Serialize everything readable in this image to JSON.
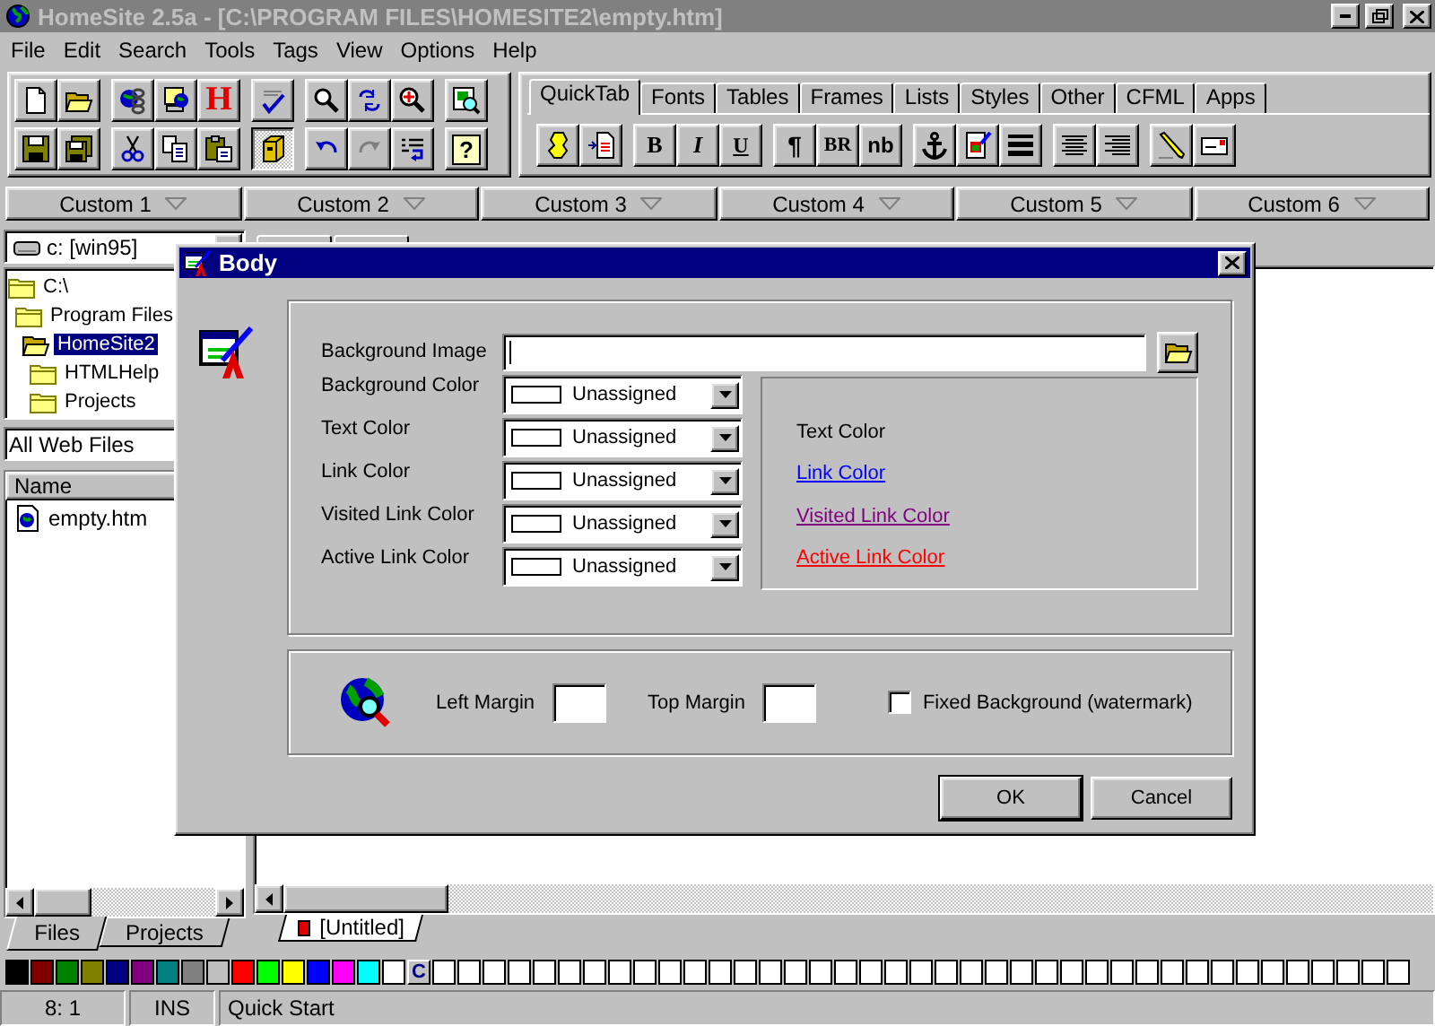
{
  "window": {
    "title": "HomeSite 2.5a - [C:\\PROGRAM FILES\\HOMESITE2\\empty.htm]",
    "active": false
  },
  "menu": [
    {
      "label": "File"
    },
    {
      "label": "Edit"
    },
    {
      "label": "Search"
    },
    {
      "label": "Tools"
    },
    {
      "label": "Tags"
    },
    {
      "label": "View"
    },
    {
      "label": "Options"
    },
    {
      "label": "Help"
    }
  ],
  "toolbar": {
    "html_button": "H",
    "help_button": "?",
    "tag_chooser_pressed": true,
    "redo_disabled": true
  },
  "quicktab": {
    "tabs": [
      {
        "label": "QuickTab",
        "selected": true
      },
      {
        "label": "Fonts",
        "selected": false
      },
      {
        "label": "Tables",
        "selected": false
      },
      {
        "label": "Frames",
        "selected": false
      },
      {
        "label": "Lists",
        "selected": false
      },
      {
        "label": "Styles",
        "selected": false
      },
      {
        "label": "Other",
        "selected": false
      },
      {
        "label": "CFML",
        "selected": false
      },
      {
        "label": "Apps",
        "selected": false
      }
    ],
    "text_buttons": [
      "B",
      "I",
      "U",
      "¶",
      "BR",
      "nb"
    ]
  },
  "custom_buttons": [
    "Custom 1",
    "Custom 2",
    "Custom 3",
    "Custom 4",
    "Custom 5",
    "Custom 6"
  ],
  "left_panel": {
    "drive": "c: [win95]",
    "tree": [
      {
        "label": "C:\\",
        "selected": false,
        "children": [
          {
            "label": "Program Files",
            "selected": false,
            "children": [
              {
                "label": "HomeSite2",
                "selected": true,
                "children": [
                  {
                    "label": "HTMLHelp",
                    "selected": false
                  },
                  {
                    "label": "Projects",
                    "selected": false
                  }
                ]
              }
            ]
          }
        ]
      }
    ],
    "filter": "All Web Files",
    "file_list": {
      "columns": [
        "Name"
      ],
      "rows": [
        "empty.htm"
      ]
    },
    "tabs": [
      {
        "label": "Files",
        "selected": true
      },
      {
        "label": "Projects",
        "selected": false
      }
    ]
  },
  "editor": {
    "doc_tabs": [
      {
        "label": "[Untitled]",
        "modified": true,
        "selected": true
      }
    ]
  },
  "palette": {
    "colors": [
      {
        "color": "#000000"
      },
      {
        "color": "#800000"
      },
      {
        "color": "#008000"
      },
      {
        "color": "#808000"
      },
      {
        "color": "#000080"
      },
      {
        "color": "#800080"
      },
      {
        "color": "#008080"
      },
      {
        "color": "#808080"
      },
      {
        "color": "#c0c0c0"
      },
      {
        "color": "#ff0000"
      },
      {
        "color": "#00ff00"
      },
      {
        "color": "#ffff00"
      },
      {
        "color": "#0000ff"
      },
      {
        "color": "#ff00ff"
      },
      {
        "color": "#00ffff"
      },
      {
        "color": "#ffffff"
      }
    ],
    "custom_button": "C",
    "custom_colors": [
      {
        "color": "#ffffff"
      },
      {
        "color": "#ffffff"
      },
      {
        "color": "#ffffff"
      },
      {
        "color": "#ffffff"
      },
      {
        "color": "#ffffff"
      },
      {
        "color": "#ffffff"
      },
      {
        "color": "#ffffff"
      },
      {
        "color": "#ffffff"
      },
      {
        "color": "#ffffff"
      },
      {
        "color": "#ffffff"
      },
      {
        "color": "#ffffff"
      },
      {
        "color": "#ffffff"
      },
      {
        "color": "#ffffff"
      },
      {
        "color": "#ffffff"
      },
      {
        "color": "#ffffff"
      },
      {
        "color": "#ffffff"
      },
      {
        "color": "#ffffff"
      },
      {
        "color": "#ffffff"
      },
      {
        "color": "#ffffff"
      },
      {
        "color": "#ffffff"
      },
      {
        "color": "#ffffff"
      },
      {
        "color": "#ffffff"
      },
      {
        "color": "#ffffff"
      },
      {
        "color": "#ffffff"
      },
      {
        "color": "#ffffff"
      },
      {
        "color": "#ffffff"
      },
      {
        "color": "#ffffff"
      },
      {
        "color": "#ffffff"
      },
      {
        "color": "#ffffff"
      },
      {
        "color": "#ffffff"
      },
      {
        "color": "#ffffff"
      },
      {
        "color": "#ffffff"
      },
      {
        "color": "#ffffff"
      },
      {
        "color": "#ffffff"
      },
      {
        "color": "#ffffff"
      },
      {
        "color": "#ffffff"
      },
      {
        "color": "#ffffff"
      },
      {
        "color": "#ffffff"
      },
      {
        "color": "#ffffff"
      }
    ]
  },
  "status_bar": [
    "8: 1",
    "INS",
    "Quick Start"
  ],
  "dialog": {
    "title": "Body",
    "background_image": {
      "label": "Background Image",
      "focused": true
    },
    "color_fields": [
      {
        "label": "Background Color",
        "value": "Unassigned"
      },
      {
        "label": "Text Color",
        "value": "Unassigned"
      },
      {
        "label": "Link Color",
        "value": "Unassigned"
      },
      {
        "label": "Visited Link Color",
        "value": "Unassigned"
      },
      {
        "label": "Active Link Color",
        "value": "Unassigned"
      }
    ],
    "preview": [
      {
        "label": "Text Color",
        "kind": "text",
        "color": "#000000"
      },
      {
        "label": "Link Color",
        "kind": "link",
        "color": "#0000ff"
      },
      {
        "label": "Visited Link Color",
        "kind": "link",
        "color": "#800080"
      },
      {
        "label": "Active Link Color",
        "kind": "link",
        "color": "#ff0000"
      }
    ],
    "margins": [
      {
        "label": "Left Margin"
      },
      {
        "label": "Top Margin"
      }
    ],
    "fixed_background": {
      "label": "Fixed Background (watermark)",
      "checked": false
    },
    "buttons": [
      {
        "label": "OK",
        "default": true
      },
      {
        "label": "Cancel",
        "default": false
      }
    ]
  }
}
